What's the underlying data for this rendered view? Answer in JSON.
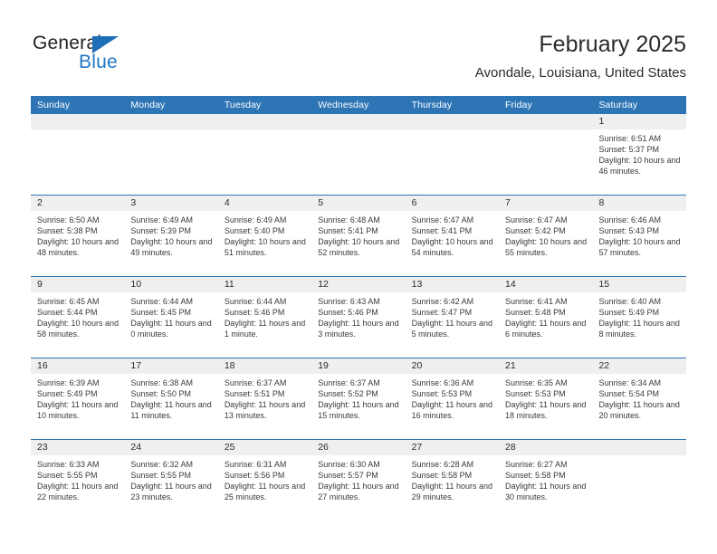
{
  "brand": {
    "name_part1": "General",
    "name_part2": "Blue",
    "triangle_icon": "triangle-icon",
    "accent_color": "#1f6fb8"
  },
  "header": {
    "title": "February 2025",
    "subtitle": "Avondale, Louisiana, United States"
  },
  "theme": {
    "header_blue": "#2e75b6",
    "day_band_gray": "#efefef",
    "text_dark": "#2b2b2b"
  },
  "calendar": {
    "weekday_headers": [
      "Sunday",
      "Monday",
      "Tuesday",
      "Wednesday",
      "Thursday",
      "Friday",
      "Saturday"
    ],
    "weeks": [
      [
        {
          "day": "",
          "empty": true,
          "lines": []
        },
        {
          "day": "",
          "empty": true,
          "lines": []
        },
        {
          "day": "",
          "empty": true,
          "lines": []
        },
        {
          "day": "",
          "empty": true,
          "lines": []
        },
        {
          "day": "",
          "empty": true,
          "lines": []
        },
        {
          "day": "",
          "empty": true,
          "lines": []
        },
        {
          "day": "1",
          "empty": false,
          "lines": [
            "Sunrise: 6:51 AM",
            "Sunset: 5:37 PM",
            "Daylight: 10 hours and 46 minutes."
          ]
        }
      ],
      [
        {
          "day": "2",
          "empty": false,
          "lines": [
            "Sunrise: 6:50 AM",
            "Sunset: 5:38 PM",
            "Daylight: 10 hours and 48 minutes."
          ]
        },
        {
          "day": "3",
          "empty": false,
          "lines": [
            "Sunrise: 6:49 AM",
            "Sunset: 5:39 PM",
            "Daylight: 10 hours and 49 minutes."
          ]
        },
        {
          "day": "4",
          "empty": false,
          "lines": [
            "Sunrise: 6:49 AM",
            "Sunset: 5:40 PM",
            "Daylight: 10 hours and 51 minutes."
          ]
        },
        {
          "day": "5",
          "empty": false,
          "lines": [
            "Sunrise: 6:48 AM",
            "Sunset: 5:41 PM",
            "Daylight: 10 hours and 52 minutes."
          ]
        },
        {
          "day": "6",
          "empty": false,
          "lines": [
            "Sunrise: 6:47 AM",
            "Sunset: 5:41 PM",
            "Daylight: 10 hours and 54 minutes."
          ]
        },
        {
          "day": "7",
          "empty": false,
          "lines": [
            "Sunrise: 6:47 AM",
            "Sunset: 5:42 PM",
            "Daylight: 10 hours and 55 minutes."
          ]
        },
        {
          "day": "8",
          "empty": false,
          "lines": [
            "Sunrise: 6:46 AM",
            "Sunset: 5:43 PM",
            "Daylight: 10 hours and 57 minutes."
          ]
        }
      ],
      [
        {
          "day": "9",
          "empty": false,
          "lines": [
            "Sunrise: 6:45 AM",
            "Sunset: 5:44 PM",
            "Daylight: 10 hours and 58 minutes."
          ]
        },
        {
          "day": "10",
          "empty": false,
          "lines": [
            "Sunrise: 6:44 AM",
            "Sunset: 5:45 PM",
            "Daylight: 11 hours and 0 minutes."
          ]
        },
        {
          "day": "11",
          "empty": false,
          "lines": [
            "Sunrise: 6:44 AM",
            "Sunset: 5:46 PM",
            "Daylight: 11 hours and 1 minute."
          ]
        },
        {
          "day": "12",
          "empty": false,
          "lines": [
            "Sunrise: 6:43 AM",
            "Sunset: 5:46 PM",
            "Daylight: 11 hours and 3 minutes."
          ]
        },
        {
          "day": "13",
          "empty": false,
          "lines": [
            "Sunrise: 6:42 AM",
            "Sunset: 5:47 PM",
            "Daylight: 11 hours and 5 minutes."
          ]
        },
        {
          "day": "14",
          "empty": false,
          "lines": [
            "Sunrise: 6:41 AM",
            "Sunset: 5:48 PM",
            "Daylight: 11 hours and 6 minutes."
          ]
        },
        {
          "day": "15",
          "empty": false,
          "lines": [
            "Sunrise: 6:40 AM",
            "Sunset: 5:49 PM",
            "Daylight: 11 hours and 8 minutes."
          ]
        }
      ],
      [
        {
          "day": "16",
          "empty": false,
          "lines": [
            "Sunrise: 6:39 AM",
            "Sunset: 5:49 PM",
            "Daylight: 11 hours and 10 minutes."
          ]
        },
        {
          "day": "17",
          "empty": false,
          "lines": [
            "Sunrise: 6:38 AM",
            "Sunset: 5:50 PM",
            "Daylight: 11 hours and 11 minutes."
          ]
        },
        {
          "day": "18",
          "empty": false,
          "lines": [
            "Sunrise: 6:37 AM",
            "Sunset: 5:51 PM",
            "Daylight: 11 hours and 13 minutes."
          ]
        },
        {
          "day": "19",
          "empty": false,
          "lines": [
            "Sunrise: 6:37 AM",
            "Sunset: 5:52 PM",
            "Daylight: 11 hours and 15 minutes."
          ]
        },
        {
          "day": "20",
          "empty": false,
          "lines": [
            "Sunrise: 6:36 AM",
            "Sunset: 5:53 PM",
            "Daylight: 11 hours and 16 minutes."
          ]
        },
        {
          "day": "21",
          "empty": false,
          "lines": [
            "Sunrise: 6:35 AM",
            "Sunset: 5:53 PM",
            "Daylight: 11 hours and 18 minutes."
          ]
        },
        {
          "day": "22",
          "empty": false,
          "lines": [
            "Sunrise: 6:34 AM",
            "Sunset: 5:54 PM",
            "Daylight: 11 hours and 20 minutes."
          ]
        }
      ],
      [
        {
          "day": "23",
          "empty": false,
          "lines": [
            "Sunrise: 6:33 AM",
            "Sunset: 5:55 PM",
            "Daylight: 11 hours and 22 minutes."
          ]
        },
        {
          "day": "24",
          "empty": false,
          "lines": [
            "Sunrise: 6:32 AM",
            "Sunset: 5:55 PM",
            "Daylight: 11 hours and 23 minutes."
          ]
        },
        {
          "day": "25",
          "empty": false,
          "lines": [
            "Sunrise: 6:31 AM",
            "Sunset: 5:56 PM",
            "Daylight: 11 hours and 25 minutes."
          ]
        },
        {
          "day": "26",
          "empty": false,
          "lines": [
            "Sunrise: 6:30 AM",
            "Sunset: 5:57 PM",
            "Daylight: 11 hours and 27 minutes."
          ]
        },
        {
          "day": "27",
          "empty": false,
          "lines": [
            "Sunrise: 6:28 AM",
            "Sunset: 5:58 PM",
            "Daylight: 11 hours and 29 minutes."
          ]
        },
        {
          "day": "28",
          "empty": false,
          "lines": [
            "Sunrise: 6:27 AM",
            "Sunset: 5:58 PM",
            "Daylight: 11 hours and 30 minutes."
          ]
        },
        {
          "day": "",
          "empty": true,
          "lines": []
        }
      ]
    ]
  }
}
